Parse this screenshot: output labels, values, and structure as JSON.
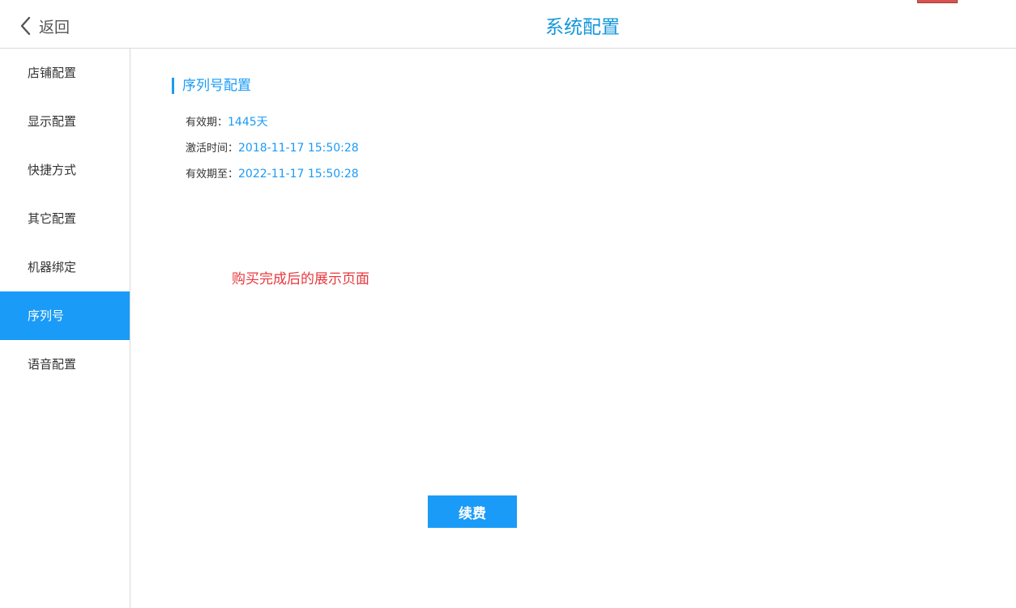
{
  "header": {
    "back_label": "返回",
    "title": "系统配置"
  },
  "sidebar": {
    "items": [
      {
        "label": "店铺配置",
        "active": false
      },
      {
        "label": "显示配置",
        "active": false
      },
      {
        "label": "快捷方式",
        "active": false
      },
      {
        "label": "其它配置",
        "active": false
      },
      {
        "label": "机器绑定",
        "active": false
      },
      {
        "label": "序列号",
        "active": true
      },
      {
        "label": "语音配置",
        "active": false
      }
    ]
  },
  "serial": {
    "section_title": "序列号配置",
    "validity_label": "有效期：",
    "validity_value": "1445天",
    "activated_label": "激活时间：",
    "activated_value": "2018-11-17 15:50:28",
    "expires_label": "有效期至：",
    "expires_value": "2022-11-17 15:50:28",
    "note": "购买完成后的展示页面",
    "renew_label": "续费"
  },
  "colors": {
    "accent": "#1a9bf7",
    "title": "#1296db",
    "note": "#e8383d",
    "corner_tab": "#d9534f"
  },
  "icons": {
    "back": "chevron-left-icon"
  }
}
